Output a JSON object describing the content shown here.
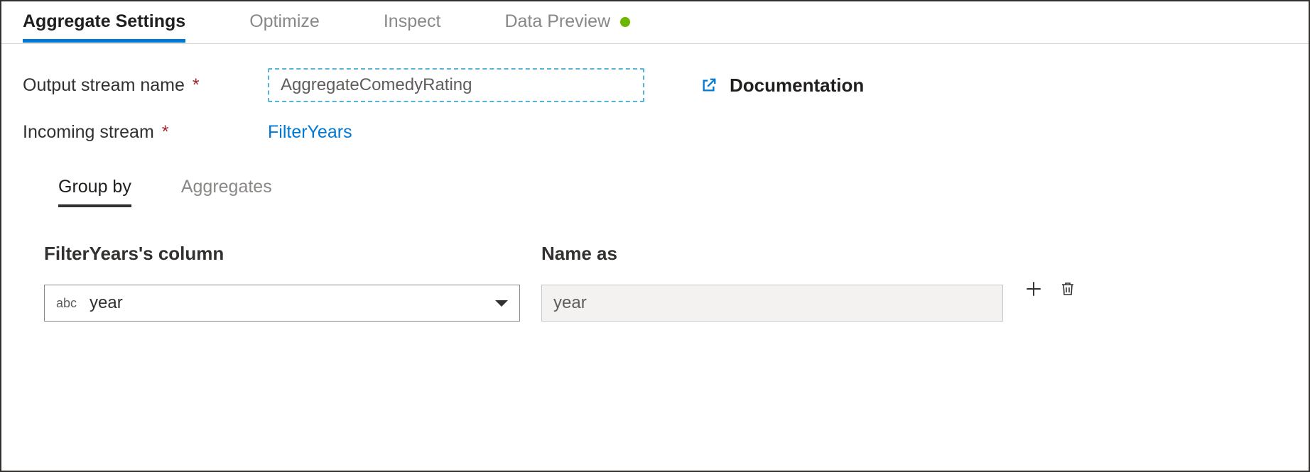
{
  "tabs": {
    "aggregate_settings": "Aggregate Settings",
    "optimize": "Optimize",
    "inspect": "Inspect",
    "data_preview": "Data Preview"
  },
  "form": {
    "output_stream_label": "Output stream name",
    "output_stream_value": "AggregateComedyRating",
    "incoming_stream_label": "Incoming stream",
    "incoming_stream_value": "FilterYears",
    "documentation_label": "Documentation"
  },
  "subtabs": {
    "group_by": "Group by",
    "aggregates": "Aggregates"
  },
  "grid": {
    "column_header": "FilterYears's column",
    "name_as_header": "Name as",
    "row": {
      "type_badge": "abc",
      "column_value": "year",
      "name_as_value": "year"
    }
  }
}
